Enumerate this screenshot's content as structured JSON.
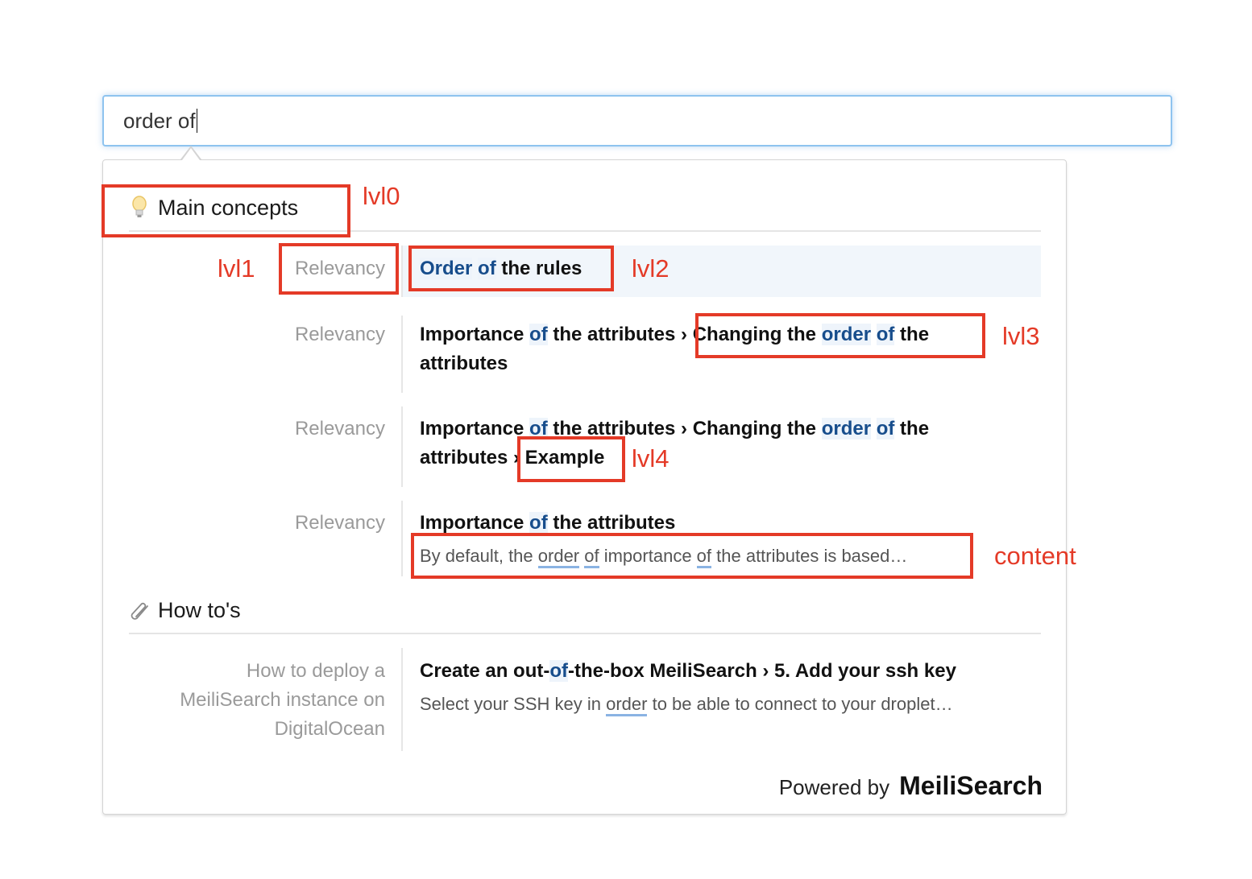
{
  "search": {
    "value": "order of"
  },
  "groups": [
    {
      "name": "Main concepts",
      "icon": "lightbulb-icon",
      "hits": [
        {
          "lvl1": "Relevancy",
          "title_parts": [
            [
              "Order",
              true
            ],
            [
              " ",
              false
            ],
            [
              "of",
              true
            ],
            [
              " the rules",
              false
            ]
          ]
        },
        {
          "lvl1": "Relevancy",
          "title_line1": "Importance of the attributes › Changing the order of the",
          "title_line2": "attributes"
        },
        {
          "lvl1": "Relevancy",
          "title_line1": "Importance of the attributes › Changing the order of the",
          "title_line2": "attributes › Example"
        },
        {
          "lvl1": "Relevancy",
          "title": "Importance of the attributes",
          "content": "By default, the order of importance of the attributes is based…"
        }
      ]
    },
    {
      "name": "How to's",
      "icon": "paperclip-icon",
      "hits": [
        {
          "lvl1_lines": [
            "How to deploy a",
            "MeiliSearch instance on",
            "DigitalOcean"
          ],
          "title": "Create an out-of-the-box MeiliSearch › 5. Add your ssh key",
          "content": "Select your SSH key in order to be able to connect to your droplet…"
        }
      ]
    }
  ],
  "footer": {
    "powered_by": "Powered by",
    "brand": "MeiliSearch"
  },
  "annotations": {
    "lvl0": "lvl0",
    "lvl1": "lvl1",
    "lvl2": "lvl2",
    "lvl3": "lvl3",
    "lvl4": "lvl4",
    "content": "content"
  },
  "colors": {
    "highlight": "#174d8c",
    "annotation": "#e43a27",
    "focus": "#8ec3ef"
  }
}
